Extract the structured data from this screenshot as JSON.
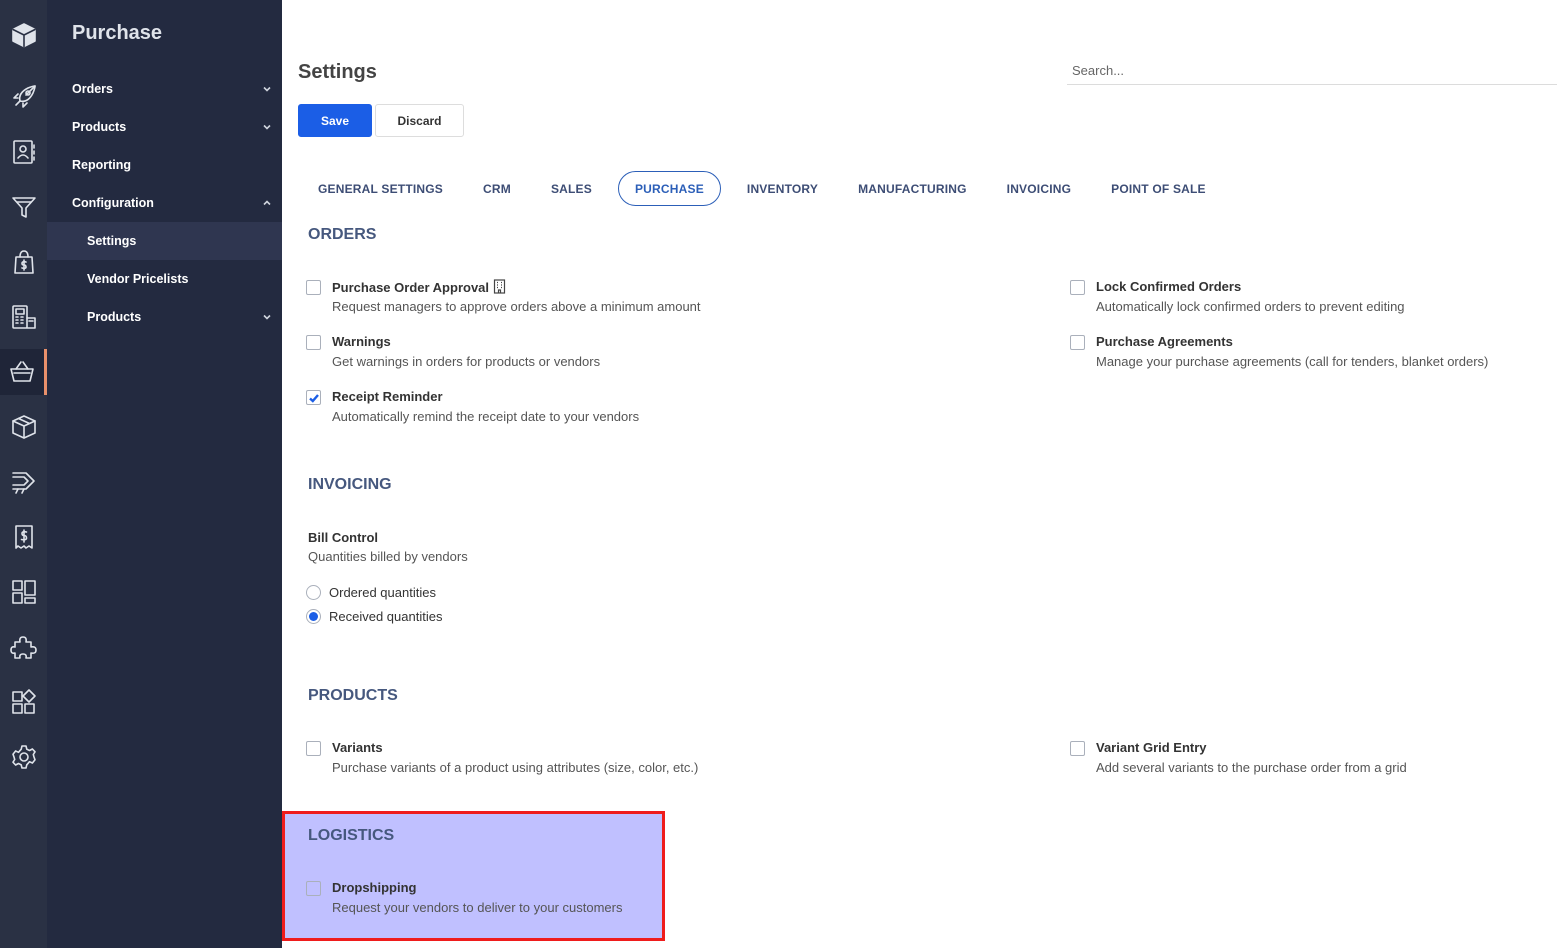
{
  "app": {
    "menu_title": "Purchase"
  },
  "rail": {
    "icons": [
      "box-logo-icon",
      "rocket-icon",
      "contacts-icon",
      "funnel-icon",
      "shopping-bag-icon",
      "point-of-sale-icon",
      "basket-icon",
      "package-icon",
      "manufacturing-icon",
      "invoice-icon",
      "dashboard-icon",
      "puzzle-icon",
      "apps-icon",
      "settings-gear-icon"
    ],
    "active": "basket-icon"
  },
  "menu": {
    "items": [
      {
        "label": "Orders",
        "chevron": "down"
      },
      {
        "label": "Products",
        "chevron": "down"
      },
      {
        "label": "Reporting"
      },
      {
        "label": "Configuration",
        "chevron": "up"
      },
      {
        "label": "Settings",
        "sub": true,
        "selected": true
      },
      {
        "label": "Vendor Pricelists",
        "sub": true
      },
      {
        "label": "Products",
        "sub": true,
        "chevron": "down"
      }
    ]
  },
  "header": {
    "title": "Settings",
    "search_placeholder": "Search...",
    "save_label": "Save",
    "discard_label": "Discard"
  },
  "tabs": [
    {
      "label": "GENERAL SETTINGS"
    },
    {
      "label": "CRM"
    },
    {
      "label": "SALES"
    },
    {
      "label": "PURCHASE",
      "active": true
    },
    {
      "label": "INVENTORY"
    },
    {
      "label": "MANUFACTURING"
    },
    {
      "label": "INVOICING"
    },
    {
      "label": "POINT OF SALE"
    }
  ],
  "sections": {
    "orders": {
      "title": "ORDERS",
      "settings": [
        {
          "label": "Purchase Order Approval",
          "desc": "Request managers to approve orders above a minimum amount",
          "checked": false,
          "icon": "building-icon"
        },
        {
          "label": "Lock Confirmed Orders",
          "desc": "Automatically lock confirmed orders to prevent editing",
          "checked": false
        },
        {
          "label": "Warnings",
          "desc": "Get warnings in orders for products or vendors",
          "checked": false
        },
        {
          "label": "Purchase Agreements",
          "desc": "Manage your purchase agreements (call for tenders, blanket orders)",
          "checked": false
        },
        {
          "label": "Receipt Reminder",
          "desc": "Automatically remind the receipt date to your vendors",
          "checked": true
        }
      ]
    },
    "invoicing": {
      "title": "INVOICING",
      "bill_control_label": "Bill Control",
      "bill_control_desc": "Quantities billed by vendors",
      "options": [
        {
          "label": "Ordered quantities",
          "selected": false
        },
        {
          "label": "Received quantities",
          "selected": true
        }
      ]
    },
    "products": {
      "title": "PRODUCTS",
      "settings": [
        {
          "label": "Variants",
          "desc": "Purchase variants of a product using attributes (size, color, etc.)",
          "checked": false
        },
        {
          "label": "Variant Grid Entry",
          "desc": "Add several variants to the purchase order from a grid",
          "checked": false
        }
      ]
    },
    "logistics": {
      "title": "LOGISTICS",
      "settings": [
        {
          "label": "Dropshipping",
          "desc": "Request your vendors to deliver to your customers",
          "checked": false
        }
      ]
    }
  },
  "colors": {
    "rail_bg": "#2a3144",
    "menu_bg": "#232a40",
    "accent": "#1b5ee6",
    "active_rail_marker": "#e8906b",
    "highlight_fill": "#8c8cff",
    "highlight_border": "#ef1c1c"
  }
}
